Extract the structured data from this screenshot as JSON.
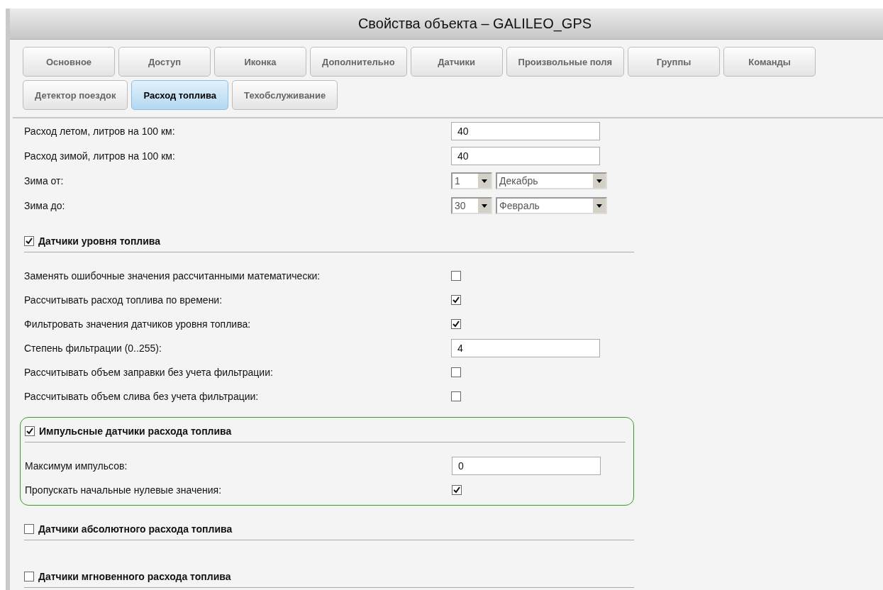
{
  "window": {
    "title": "Свойства объекта – GALILEO_GPS"
  },
  "tab_rows": [
    {
      "tabs": [
        {
          "label": "Основное",
          "selected": false
        },
        {
          "label": "Доступ",
          "selected": false
        },
        {
          "label": "Иконка",
          "selected": false
        },
        {
          "label": "Дополнительно",
          "selected": false
        },
        {
          "label": "Датчики",
          "selected": false
        },
        {
          "label": "Произвольные поля",
          "selected": false
        },
        {
          "label": "Группы",
          "selected": false
        },
        {
          "label": "Команды",
          "selected": false
        }
      ]
    },
    {
      "tabs": [
        {
          "label": "Детектор поездок",
          "selected": false
        },
        {
          "label": "Расход топлива",
          "selected": true
        },
        {
          "label": "Техобслуживание",
          "selected": false
        }
      ]
    }
  ],
  "sections": [
    {
      "highlighted": false,
      "rows": [
        {
          "kind": "input",
          "label": "Расход летом, литров на 100 км:",
          "value": "40"
        },
        {
          "kind": "input",
          "label": "Расход зимой, литров на 100 км:",
          "value": "40"
        },
        {
          "kind": "selects",
          "label": "Зима от:",
          "selects": [
            "1",
            "Декабрь"
          ]
        },
        {
          "kind": "selects",
          "label": "Зима до:",
          "selects": [
            "30",
            "Февраль"
          ]
        }
      ]
    },
    {
      "header": {
        "label": "Датчики уровня топлива",
        "checked": true
      },
      "highlighted": false,
      "rows": [
        {
          "kind": "checkbox",
          "label": "Заменять ошибочные значения рассчитанными математически:",
          "checked": false
        },
        {
          "kind": "checkbox",
          "label": "Рассчитывать расход топлива по времени:",
          "checked": true
        },
        {
          "kind": "checkbox",
          "label": "Фильтровать значения датчиков уровня топлива:",
          "checked": true
        },
        {
          "kind": "input",
          "label": "Степень фильтрации (0..255):",
          "value": "4"
        },
        {
          "kind": "checkbox",
          "label": "Рассчитывать объем заправки без учета фильтрации:",
          "checked": false
        },
        {
          "kind": "checkbox",
          "label": "Рассчитывать объем слива без учета фильтрации:",
          "checked": false
        }
      ]
    },
    {
      "header": {
        "label": "Импульсные датчики расхода топлива",
        "checked": true
      },
      "highlighted": true,
      "rows": [
        {
          "kind": "input",
          "label": "Максимум импульсов:",
          "value": "0"
        },
        {
          "kind": "checkbox",
          "label": "Пропускать начальные нулевые значения:",
          "checked": true
        }
      ]
    },
    {
      "header": {
        "label": "Датчики абсолютного расхода топлива",
        "checked": false
      },
      "highlighted": false
    },
    {
      "header": {
        "label": "Датчики мгновенного расхода топлива",
        "checked": false
      },
      "highlighted": false
    }
  ]
}
